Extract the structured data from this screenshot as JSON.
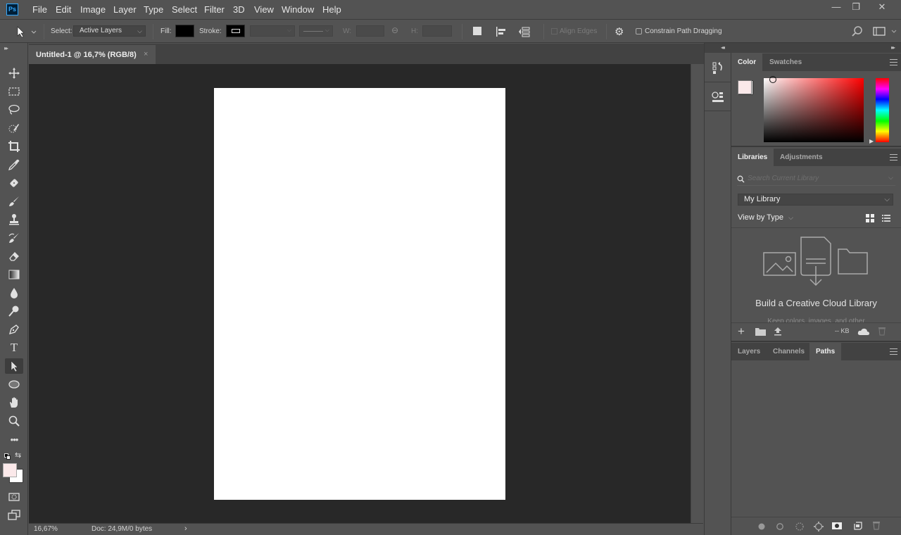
{
  "app": {
    "logo": "Ps"
  },
  "menu": [
    "File",
    "Edit",
    "Image",
    "Layer",
    "Type",
    "Select",
    "Filter",
    "3D",
    "View",
    "Window",
    "Help"
  ],
  "window_controls": {
    "minimize": "—",
    "restore": "❐",
    "close": "✕"
  },
  "options_bar": {
    "select_label": "Select:",
    "select_value": "Active Layers",
    "fill_label": "Fill:",
    "fill_color": "#000000",
    "stroke_label": "Stroke:",
    "w_label": "W:",
    "h_label": "H:",
    "w_value": "",
    "h_value": "",
    "align_edges_label": "Align Edges",
    "align_edges_checked": false,
    "constrain_label": "Constrain Path Dragging",
    "constrain_checked": false
  },
  "document": {
    "tab_title": "Untitled-1 @ 16,7% (RGB/8)",
    "close_glyph": "×",
    "zoom": "16,67%",
    "doc_info": "Doc: 24,9M/0 bytes",
    "status_arrow": "›"
  },
  "tools": [
    {
      "name": "move-tool"
    },
    {
      "name": "rectangular-marquee-tool"
    },
    {
      "name": "lasso-tool"
    },
    {
      "name": "quick-selection-tool"
    },
    {
      "name": "crop-tool"
    },
    {
      "name": "eyedropper-tool"
    },
    {
      "name": "spot-healing-brush-tool"
    },
    {
      "name": "brush-tool"
    },
    {
      "name": "clone-stamp-tool"
    },
    {
      "name": "history-brush-tool"
    },
    {
      "name": "eraser-tool"
    },
    {
      "name": "gradient-tool"
    },
    {
      "name": "blur-tool"
    },
    {
      "name": "dodge-tool"
    },
    {
      "name": "pen-tool"
    },
    {
      "name": "type-tool",
      "glyph": "T"
    },
    {
      "name": "path-selection-tool",
      "active": true
    },
    {
      "name": "ellipse-tool"
    },
    {
      "name": "hand-tool"
    },
    {
      "name": "zoom-tool"
    },
    {
      "name": "edit-toolbar",
      "glyph": "•••"
    }
  ],
  "colors": {
    "foreground": "#fbe9ea",
    "background": "#ffffff",
    "accent": "#31a8ff"
  },
  "panels": {
    "color": {
      "tabs": [
        "Color",
        "Swatches"
      ],
      "active_tab": "Color",
      "hue": "#ff0000"
    },
    "libraries": {
      "tabs": [
        "Libraries",
        "Adjustments"
      ],
      "active_tab": "Libraries",
      "search_placeholder": "Search Current Library",
      "library_select": "My Library",
      "view_by": "View by Type",
      "empty_title": "Build a Creative Cloud Library",
      "empty_sub": "Keep colors, images, and other",
      "size": "-- KB"
    },
    "layers": {
      "tabs": [
        "Layers",
        "Channels",
        "Paths"
      ],
      "active_tab": "Paths"
    }
  }
}
